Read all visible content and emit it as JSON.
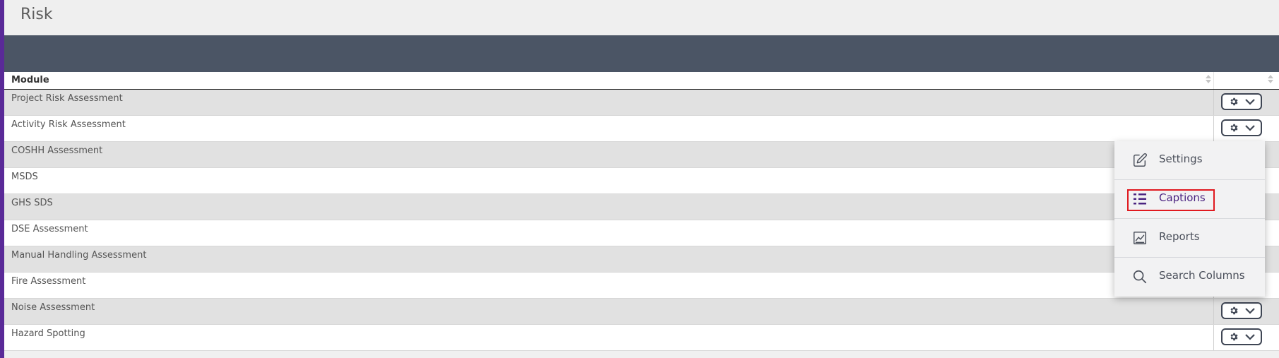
{
  "page": {
    "title": "Risk"
  },
  "table": {
    "headers": {
      "module": "Module"
    },
    "rows": [
      {
        "module": "Project Risk Assessment"
      },
      {
        "module": "Activity Risk Assessment"
      },
      {
        "module": "COSHH Assessment"
      },
      {
        "module": "MSDS"
      },
      {
        "module": "GHS SDS"
      },
      {
        "module": "DSE Assessment"
      },
      {
        "module": "Manual Handling Assessment"
      },
      {
        "module": "Fire Assessment"
      },
      {
        "module": "Noise Assessment"
      },
      {
        "module": "Hazard Spotting"
      }
    ]
  },
  "context_menu": {
    "items": [
      {
        "label": "Settings",
        "icon": "edit-icon"
      },
      {
        "label": "Captions",
        "icon": "captions-icon",
        "highlighted": true
      },
      {
        "label": "Reports",
        "icon": "reports-icon"
      },
      {
        "label": "Search Columns",
        "icon": "search-icon"
      }
    ]
  },
  "colors": {
    "accent": "#5a2a98",
    "header_band": "#4b5565",
    "highlight_border": "#e0191f",
    "active_menu_text": "#4b2481"
  }
}
